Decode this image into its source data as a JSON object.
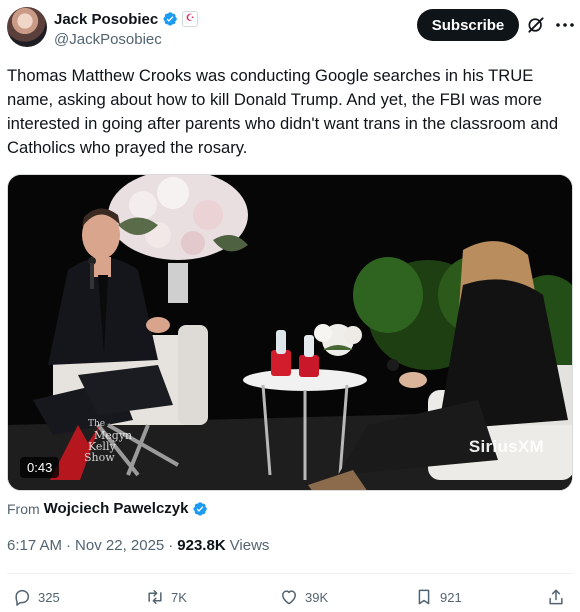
{
  "author": {
    "name": "Jack Posobiec",
    "handle": "@JackPosobiec",
    "affiliate_badge": "☪"
  },
  "header": {
    "subscribe_label": "Subscribe",
    "grok_icon": "grok-icon",
    "more_icon": "more-icon"
  },
  "tweet": {
    "text": "Thomas Matthew Crooks was conducting Google searches in his TRUE name, asking about how to kill Donald Trump. And yet, the FBI was more interested in going after parents who didn't want trans in the classroom and Catholics who prayed the rosary."
  },
  "media": {
    "duration": "0:43",
    "watermark": "SiriusXM",
    "show_logo_lines": [
      "The",
      "Megyn",
      "Kelly",
      "Show"
    ]
  },
  "source": {
    "prefix": "From",
    "name": "Wojciech Pawelczyk"
  },
  "meta": {
    "time": "6:17 AM",
    "separator": "·",
    "date": "Nov 22, 2025",
    "views_count": "923.8K",
    "views_label": "Views"
  },
  "actions": {
    "replies": "325",
    "reposts": "7K",
    "likes": "39K",
    "bookmarks": "921"
  },
  "colors": {
    "verified_blue": "#1d9bf0",
    "text_primary": "#0f1419",
    "text_secondary": "#536471",
    "button_bg": "#0f1419"
  }
}
